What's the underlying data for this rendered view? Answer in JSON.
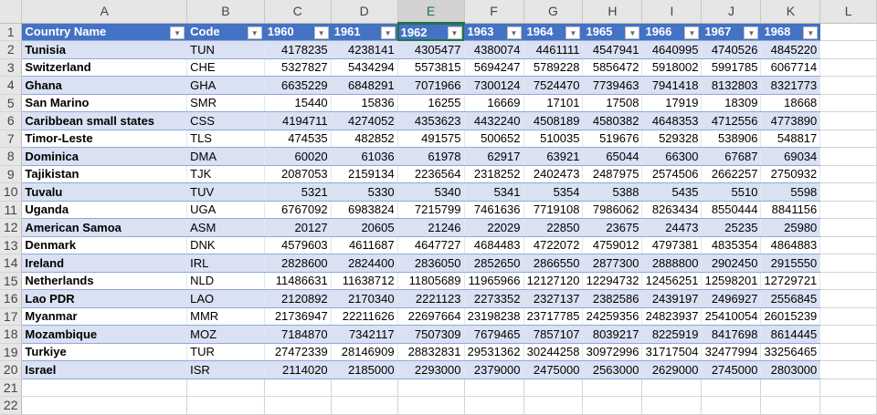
{
  "columns": [
    "A",
    "B",
    "C",
    "D",
    "E",
    "F",
    "G",
    "H",
    "I",
    "J",
    "K",
    "L"
  ],
  "headers": [
    "Country Name",
    "Code",
    "1960",
    "1961",
    "1962",
    "1963",
    "1964",
    "1965",
    "1966",
    "1967",
    "1968"
  ],
  "rows": [
    [
      "Tunisia",
      "TUN",
      "4178235",
      "4238141",
      "4305477",
      "4380074",
      "4461111",
      "4547941",
      "4640995",
      "4740526",
      "4845220"
    ],
    [
      "Switzerland",
      "CHE",
      "5327827",
      "5434294",
      "5573815",
      "5694247",
      "5789228",
      "5856472",
      "5918002",
      "5991785",
      "6067714"
    ],
    [
      "Ghana",
      "GHA",
      "6635229",
      "6848291",
      "7071966",
      "7300124",
      "7524470",
      "7739463",
      "7941418",
      "8132803",
      "8321773"
    ],
    [
      "San Marino",
      "SMR",
      "15440",
      "15836",
      "16255",
      "16669",
      "17101",
      "17508",
      "17919",
      "18309",
      "18668"
    ],
    [
      "Caribbean small states",
      "CSS",
      "4194711",
      "4274052",
      "4353623",
      "4432240",
      "4508189",
      "4580382",
      "4648353",
      "4712556",
      "4773890"
    ],
    [
      "Timor-Leste",
      "TLS",
      "474535",
      "482852",
      "491575",
      "500652",
      "510035",
      "519676",
      "529328",
      "538906",
      "548817"
    ],
    [
      "Dominica",
      "DMA",
      "60020",
      "61036",
      "61978",
      "62917",
      "63921",
      "65044",
      "66300",
      "67687",
      "69034"
    ],
    [
      "Tajikistan",
      "TJK",
      "2087053",
      "2159134",
      "2236564",
      "2318252",
      "2402473",
      "2487975",
      "2574506",
      "2662257",
      "2750932"
    ],
    [
      "Tuvalu",
      "TUV",
      "5321",
      "5330",
      "5340",
      "5341",
      "5354",
      "5388",
      "5435",
      "5510",
      "5598"
    ],
    [
      "Uganda",
      "UGA",
      "6767092",
      "6983824",
      "7215799",
      "7461636",
      "7719108",
      "7986062",
      "8263434",
      "8550444",
      "8841156"
    ],
    [
      "American Samoa",
      "ASM",
      "20127",
      "20605",
      "21246",
      "22029",
      "22850",
      "23675",
      "24473",
      "25235",
      "25980"
    ],
    [
      "Denmark",
      "DNK",
      "4579603",
      "4611687",
      "4647727",
      "4684483",
      "4722072",
      "4759012",
      "4797381",
      "4835354",
      "4864883"
    ],
    [
      "Ireland",
      "IRL",
      "2828600",
      "2824400",
      "2836050",
      "2852650",
      "2866550",
      "2877300",
      "2888800",
      "2902450",
      "2915550"
    ],
    [
      "Netherlands",
      "NLD",
      "11486631",
      "11638712",
      "11805689",
      "11965966",
      "12127120",
      "12294732",
      "12456251",
      "12598201",
      "12729721"
    ],
    [
      "Lao PDR",
      "LAO",
      "2120892",
      "2170340",
      "2221123",
      "2273352",
      "2327137",
      "2382586",
      "2439197",
      "2496927",
      "2556845"
    ],
    [
      "Myanmar",
      "MMR",
      "21736947",
      "22211626",
      "22697664",
      "23198238",
      "23717785",
      "24259356",
      "24823937",
      "25410054",
      "26015239"
    ],
    [
      "Mozambique",
      "MOZ",
      "7184870",
      "7342117",
      "7507309",
      "7679465",
      "7857107",
      "8039217",
      "8225919",
      "8417698",
      "8614445"
    ],
    [
      "Turkiye",
      "TUR",
      "27472339",
      "28146909",
      "28832831",
      "29531362",
      "30244258",
      "30972996",
      "31717504",
      "32477994",
      "33256465"
    ],
    [
      "Israel",
      "ISR",
      "2114020",
      "2185000",
      "2293000",
      "2379000",
      "2475000",
      "2563000",
      "2629000",
      "2745000",
      "2803000"
    ]
  ],
  "row_numbers": [
    "1",
    "2",
    "3",
    "4",
    "5",
    "6",
    "7",
    "8",
    "9",
    "10",
    "11",
    "12",
    "13",
    "14",
    "15",
    "16",
    "17",
    "18",
    "19",
    "20",
    "21",
    "22"
  ],
  "active_column": "E",
  "colors": {
    "header": "#4472c4",
    "band": "#d9e1f2",
    "selection": "#217346"
  }
}
